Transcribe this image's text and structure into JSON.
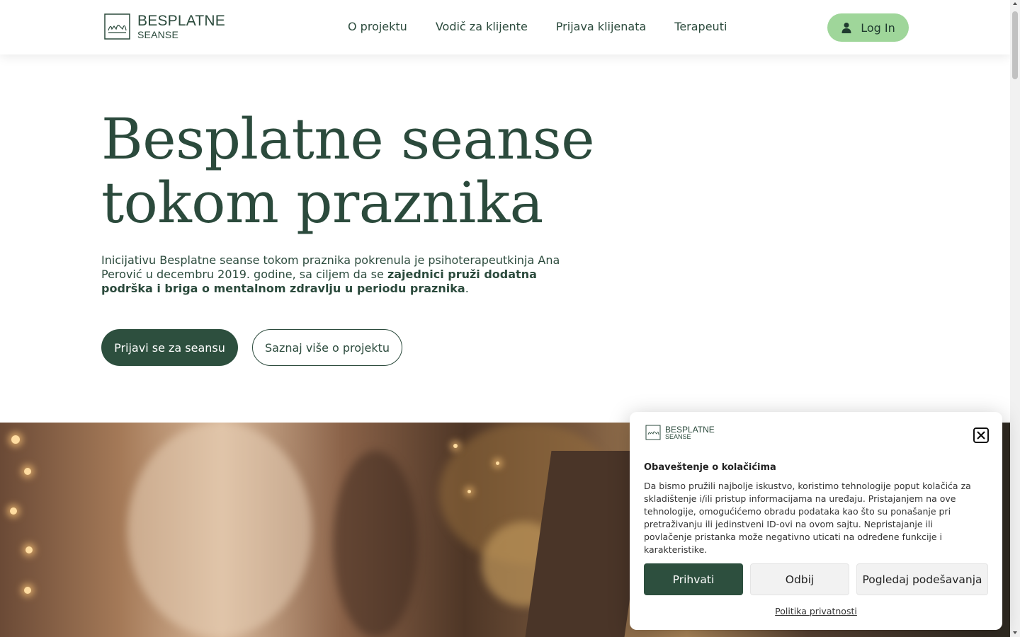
{
  "header": {
    "logo_line1": "BESPLATNE",
    "logo_line2": "SEANSE",
    "nav": [
      {
        "label": "O projektu"
      },
      {
        "label": "Vodič za klijente"
      },
      {
        "label": "Prijava klijenata"
      },
      {
        "label": "Terapeuti"
      }
    ],
    "login_label": "Log In",
    "login_icon": "user-icon"
  },
  "hero": {
    "title_line1": "Besplatne seanse",
    "title_line2": "tokom praznika",
    "text_plain": "Inicijativu Besplatne seanse tokom praznika pokrenula je psihoterapeutkinja Ana Perović u decembru 2019. godine, sa ciljem da se ",
    "text_bold": "zajednici pruži dodatna podrška i briga o mentalnom zdravlju u periodu praznika",
    "text_end": ".",
    "primary_button": "Prijavi se za seansu",
    "secondary_button": "Saznaj više o projektu"
  },
  "cookie": {
    "logo_line1": "BESPLATNE",
    "logo_line2": "SEANSE",
    "title": "Obaveštenje o kolačićima",
    "body": "Da bismo pružili najbolje iskustvo, koristimo tehnologije poput kolačića za skladištenje i/ili pristup informacijama na uređaju. Pristajanjem na ove tehnologije, omogućićemo obradu podataka kao što su ponašanje pri pretraživanju ili jedinstveni ID-ovi na ovom sajtu. Nepristajanje ili povlačenje pristanka može negativno uticati na određene funkcije i karakteristike.",
    "accept": "Prihvati",
    "deny": "Odbij",
    "preferences": "Pogledaj podešavanja",
    "privacy_link": "Politika privatnosti",
    "close_icon": "close-icon"
  },
  "colors": {
    "brand_green": "#2d4f3e",
    "login_green": "#9fd69a",
    "text_green": "#2b4a3c"
  }
}
